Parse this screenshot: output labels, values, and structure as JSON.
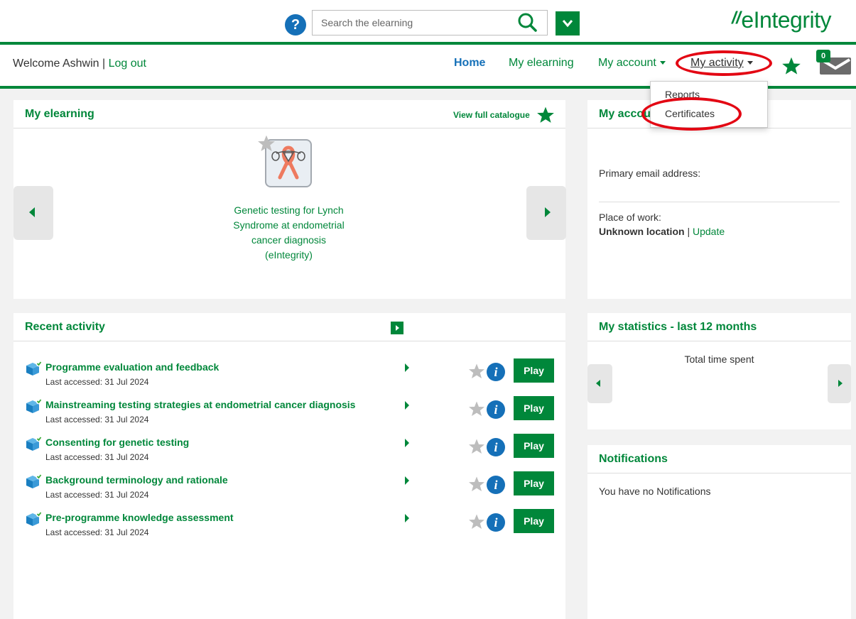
{
  "header": {
    "help_label": "?",
    "search_placeholder": "Search the elearning",
    "logo_text": "eIntegrity"
  },
  "nav": {
    "welcome": "Welcome Ashwin",
    "separator": "|",
    "logout": "Log out",
    "home": "Home",
    "my_elearning": "My elearning",
    "my_account": "My account",
    "my_activity": "My activity",
    "notifications_count": "0"
  },
  "dropdown": {
    "items": [
      "Reports",
      "Certificates"
    ]
  },
  "my_elearning": {
    "title": "My elearning",
    "view_catalogue": "View full catalogue",
    "course_title": "Genetic testing for Lynch Syndrome at endometrial cancer diagnosis (eIntegrity)"
  },
  "my_account": {
    "title": "My account",
    "primary_email_label": "Primary email address:",
    "place_of_work_label": "Place of work:",
    "place_of_work_value": "Unknown location",
    "update_link": "Update"
  },
  "recent_activity": {
    "title": "Recent activity",
    "play_label": "Play",
    "info_label": "i",
    "items": [
      {
        "title": "Programme evaluation and feedback",
        "last_accessed": "Last accessed: 31 Jul 2024"
      },
      {
        "title": "Mainstreaming testing strategies at endometrial cancer diagnosis",
        "last_accessed": "Last accessed: 31 Jul 2024"
      },
      {
        "title": "Consenting for genetic testing",
        "last_accessed": "Last accessed: 31 Jul 2024"
      },
      {
        "title": "Background terminology and rationale",
        "last_accessed": "Last accessed: 31 Jul 2024"
      },
      {
        "title": "Pre-programme knowledge assessment",
        "last_accessed": "Last accessed: 31 Jul 2024"
      }
    ]
  },
  "statistics": {
    "title": "My statistics - last 12 months",
    "label": "Total time spent"
  },
  "notifications": {
    "title": "Notifications",
    "empty_text": "You have no Notifications"
  },
  "colors": {
    "brand_green": "#00873a",
    "link_blue": "#1570b8",
    "highlight_red": "#e30613"
  }
}
